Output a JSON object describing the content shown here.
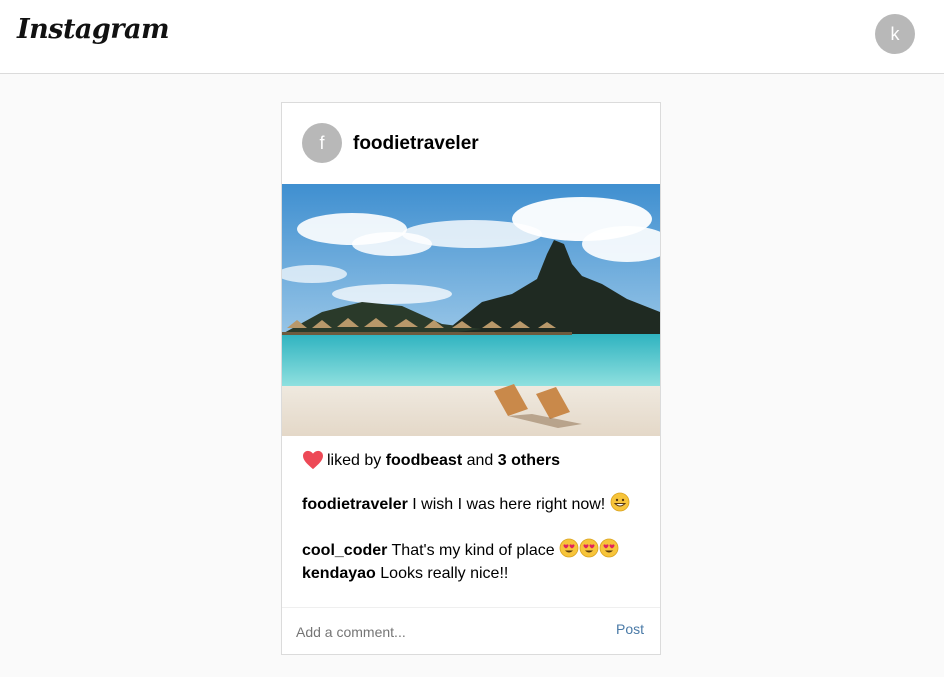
{
  "header": {
    "logo_text": "Instagram",
    "user_avatar_letter": "k"
  },
  "post": {
    "avatar_letter": "f",
    "username": "foodietraveler",
    "image_icon": "beach-photo",
    "likes": {
      "icon": "heart-icon",
      "prefix": "liked by",
      "user": "foodbeast",
      "joiner": "and",
      "others": "3 others"
    },
    "caption": {
      "user": "foodietraveler",
      "text": "I wish I was here right now!",
      "emoji": "grinning-face"
    },
    "comments": [
      {
        "user": "cool_coder",
        "text": "That's my kind of place",
        "emoji": "heart-eyes x3"
      },
      {
        "user": "kendayao",
        "text": "Looks really nice!!"
      }
    ],
    "add_comment": {
      "placeholder": "Add a comment...",
      "post_label": "Post"
    }
  },
  "colors": {
    "heart": "#ed4956",
    "post_button": "#4a7aa7",
    "avatar_bg": "#b8b8b8"
  }
}
